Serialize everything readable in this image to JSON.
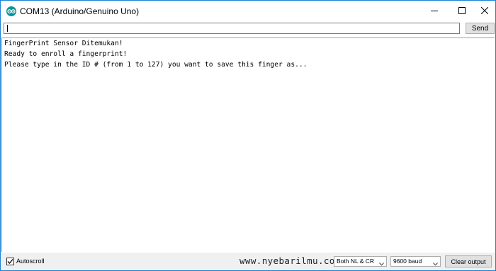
{
  "window": {
    "title": "COM13 (Arduino/Genuino Uno)",
    "app_icon": "arduino-logo-icon",
    "controls": [
      "minimize-icon",
      "maximize-icon",
      "close-icon"
    ]
  },
  "input_bar": {
    "value": "",
    "send_label": "Send"
  },
  "output": {
    "lines": [
      "FingerPrint Sensor Ditemukan!",
      "Ready to enroll a fingerprint!",
      "Please type in the ID # (from 1 to 127) you want to save this finger as..."
    ]
  },
  "bottom_bar": {
    "autoscroll_label": "Autoscroll",
    "autoscroll_checked": true,
    "watermark": "www.nyebarilmu.com",
    "line_ending": "Both NL & CR",
    "baud_rate": "9600 baud",
    "clear_label": "Clear output"
  },
  "colors": {
    "window_border": "#1883d7",
    "arduino_teal": "#00979c",
    "button_face": "#e1e1e1",
    "statusbar_bg": "#f0f0f0"
  }
}
